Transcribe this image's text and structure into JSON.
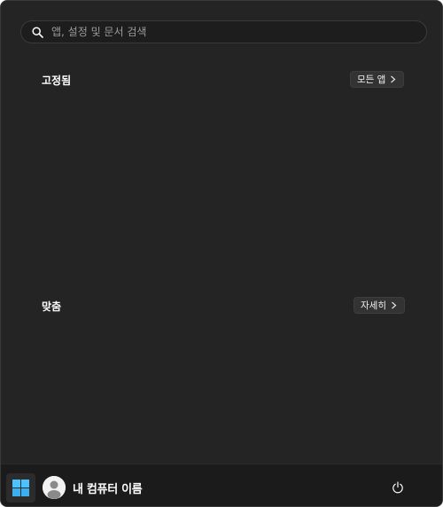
{
  "search": {
    "placeholder": "앱, 설정 및 문서 검색",
    "icon": "search-icon"
  },
  "pinned": {
    "title": "고정됨",
    "all_apps_label": "모든 앱",
    "icon": "chevron-right-icon"
  },
  "recommended": {
    "title": "맞춤",
    "more_label": "자세히",
    "icon": "chevron-right-icon"
  },
  "taskbar": {
    "start_icon": "windows-logo-icon",
    "user_name": "내 컴퓨터 이름",
    "avatar_icon": "user-avatar-icon",
    "power_icon": "power-icon"
  },
  "colors": {
    "menu_background": "#242424",
    "taskbar_background": "#1b1b1b",
    "windows_logo": "#4cc2ff"
  }
}
